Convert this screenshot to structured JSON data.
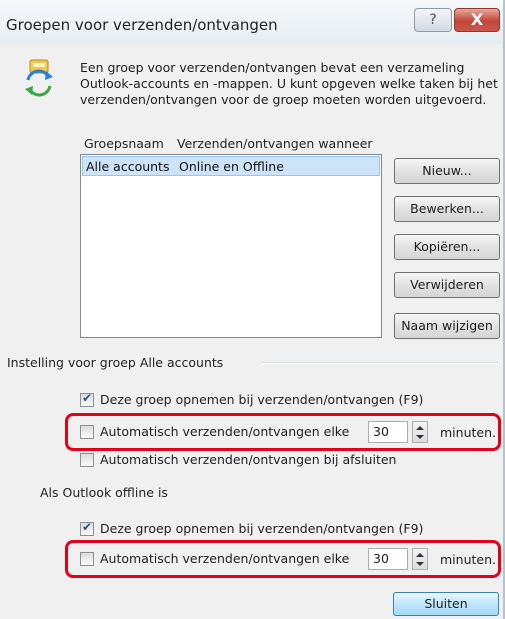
{
  "window": {
    "title": "Groepen voor verzenden/ontvangen",
    "help_glyph": "?",
    "close_glyph": "X"
  },
  "description": "Een groep voor verzenden/ontvangen bevat een verzameling Outlook-accounts en -mappen. U kunt opgeven welke taken bij het verzenden/ontvangen voor de groep moeten worden uitgevoerd.",
  "icons": {
    "header": "send-receive-sync-icon",
    "checkmark": "check-icon",
    "spin_up": "spin-up-icon",
    "spin_down": "spin-down-icon"
  },
  "group_list": {
    "columns": [
      "Groepsnaam",
      "Verzenden/ontvangen wanneer"
    ],
    "rows": [
      {
        "name": "Alle accounts",
        "when": "Online en Offline",
        "selected": true
      }
    ]
  },
  "buttons": {
    "new": "Nieuw...",
    "edit": "Bewerken...",
    "copy": "Kopiëren...",
    "delete": "Verwijderen",
    "rename": "Naam wijzigen",
    "close": "Sluiten"
  },
  "online_section": {
    "title": "Instelling voor groep Alle accounts",
    "include": {
      "label": "Deze groep opnemen bij verzenden/ontvangen (F9)",
      "checked": true
    },
    "auto_every": {
      "label": "Automatisch verzenden/ontvangen elke",
      "checked": false,
      "value": "30",
      "unit": "minuten."
    },
    "auto_exit": {
      "label": "Automatisch verzenden/ontvangen bij afsluiten",
      "checked": false
    }
  },
  "offline_section": {
    "title": "Als Outlook offline is",
    "include": {
      "label": "Deze groep opnemen bij verzenden/ontvangen (F9)",
      "checked": true
    },
    "auto_every": {
      "label": "Automatisch verzenden/ontvangen elke",
      "checked": false,
      "value": "30",
      "unit": "minuten."
    }
  },
  "colors": {
    "highlight": "#e3001b",
    "selection": "#cde3f7",
    "close_button": "#c1473a"
  }
}
